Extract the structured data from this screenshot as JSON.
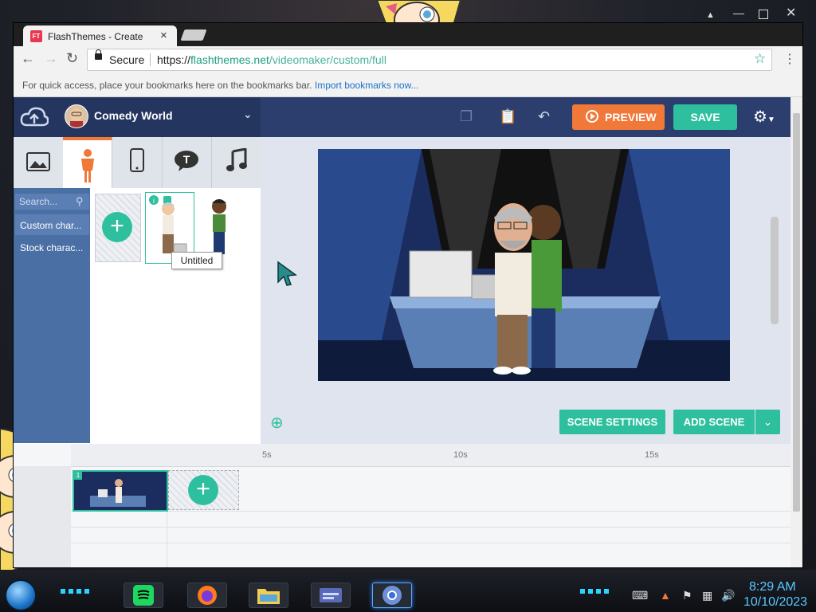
{
  "browser": {
    "tab_title": "FlashThemes - Create",
    "tab_favicon": "FT",
    "secure_label": "Secure",
    "url_scheme": "https://",
    "url_host": "flashthemes.net",
    "url_path": "/videomaker/custom/full",
    "bookmarks_hint": "For quick access, place your bookmarks here on the bookmarks bar.",
    "import_bookmarks": "Import bookmarks now..."
  },
  "app": {
    "theme_name": "Comedy World",
    "preview_label": "PREVIEW",
    "save_label": "SAVE",
    "search_placeholder": "Search...",
    "categories": [
      "Custom char...",
      "Stock charac..."
    ],
    "tooltip": "Untitled",
    "scene_settings": "SCENE SETTINGS",
    "add_scene": "ADD SCENE",
    "timeline_marks": [
      "5s",
      "10s",
      "15s"
    ],
    "scene_number": "1"
  },
  "taskbar": {
    "time": "8:29 AM",
    "date": "10/10/2023"
  },
  "colors": {
    "accent_green": "#2ec09e",
    "preview_orange": "#f07838",
    "topbar_blue": "#2c3e6e",
    "category_blue": "#4a6fa5"
  }
}
